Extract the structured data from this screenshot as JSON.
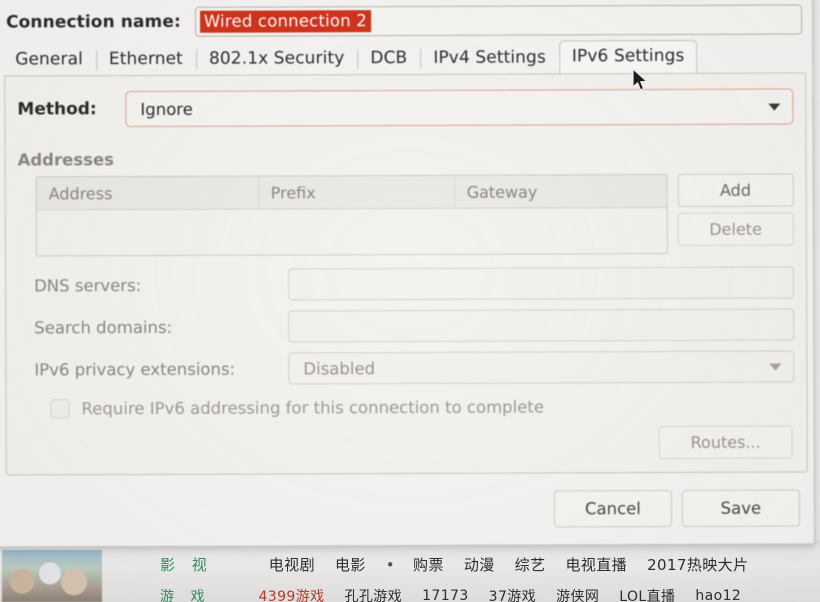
{
  "dialog": {
    "connection_name_label": "Connection name:",
    "connection_name_value": "Wired connection 2",
    "selection_color": "#d1341d",
    "focus_border_color": "#e2a290",
    "tabs": [
      {
        "label": "General",
        "active": false
      },
      {
        "label": "Ethernet",
        "active": false
      },
      {
        "label": "802.1x Security",
        "active": false
      },
      {
        "label": "DCB",
        "active": false
      },
      {
        "label": "IPv4 Settings",
        "active": false
      },
      {
        "label": "IPv6 Settings",
        "active": true
      }
    ],
    "ipv6": {
      "method_label": "Method:",
      "method_value": "Ignore",
      "addresses_heading": "Addresses",
      "table_headers": {
        "address": "Address",
        "prefix": "Prefix",
        "gateway": "Gateway"
      },
      "table_rows": [],
      "add_button": "Add",
      "delete_button": "Delete",
      "dns_label": "DNS servers:",
      "dns_value": "",
      "search_label": "Search domains:",
      "search_value": "",
      "privacy_label": "IPv6 privacy extensions:",
      "privacy_value": "Disabled",
      "require_checkbox_label": "Require IPv6 addressing for this connection to complete",
      "require_checkbox_checked": false,
      "routes_button": "Routes..."
    },
    "cancel_button": "Cancel",
    "save_button": "Save"
  },
  "background": {
    "nav_row1": {
      "category": "影 视",
      "links": [
        "电视剧",
        "电影",
        "•",
        "购票",
        "动漫",
        "综艺",
        "电视直播",
        "2017热映大片"
      ]
    },
    "nav_row2": {
      "category": "游 戏",
      "links": [
        "4399游戏",
        "孔孔游戏",
        "17173",
        "37游戏",
        "游侠网",
        "LOL直播",
        "hao12"
      ]
    }
  }
}
